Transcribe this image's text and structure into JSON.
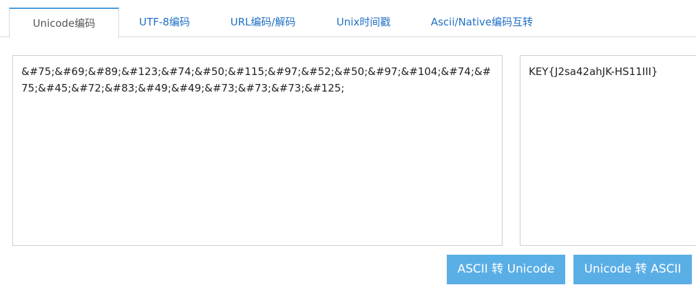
{
  "tabs": [
    {
      "label": "Unicode编码",
      "active": true
    },
    {
      "label": "UTF-8编码",
      "active": false
    },
    {
      "label": "URL编码/解码",
      "active": false
    },
    {
      "label": "Unix时间戳",
      "active": false
    },
    {
      "label": "Ascii/Native编码互转",
      "active": false
    }
  ],
  "input": {
    "value": "&#75;&#69;&#89;&#123;&#74;&#50;&#115;&#97;&#52;&#50;&#97;&#104;&#74;&#75;&#45;&#72;&#83;&#49;&#49;&#73;&#73;&#73;&#125;"
  },
  "output": {
    "value": "KEY{J2sa42ahJK-HS11III}"
  },
  "buttons": {
    "ascii_to_unicode": "ASCII 转 Unicode",
    "unicode_to_ascii": "Unicode 转 ASCII"
  },
  "colors": {
    "accent": "#1f6fc5",
    "button": "#5aaee6",
    "active_tab_top": "#4a9ad8"
  }
}
